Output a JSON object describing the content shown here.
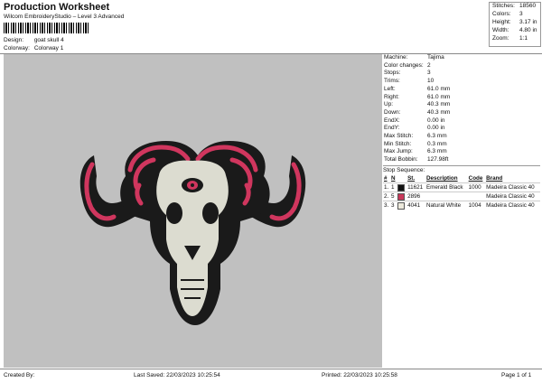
{
  "header": {
    "title": "Production Worksheet",
    "subtitle": "Wilcom EmbroideryStudio – Level 3 Advanced"
  },
  "meta": [
    {
      "label": "Design:",
      "value": "goat skull 4"
    },
    {
      "label": "Colorway:",
      "value": "Colorway 1"
    }
  ],
  "stats": [
    {
      "label": "Stitches:",
      "value": "18560"
    },
    {
      "label": "Colors:",
      "value": "3"
    },
    {
      "label": "Height:",
      "value": "3.17 in"
    },
    {
      "label": "Width:",
      "value": "4.80 in"
    },
    {
      "label": "Zoom:",
      "value": "1:1"
    }
  ],
  "properties": [
    {
      "label": "Machine:",
      "value": "Tajima"
    },
    {
      "label": "Color changes:",
      "value": "2"
    },
    {
      "label": "Stops:",
      "value": "3"
    },
    {
      "label": "Trims:",
      "value": "10"
    },
    {
      "label": "Left:",
      "value": "61.0 mm"
    },
    {
      "label": "Right:",
      "value": "61.0 mm"
    },
    {
      "label": "Up:",
      "value": "40.3 mm"
    },
    {
      "label": "Down:",
      "value": "40.3 mm"
    },
    {
      "label": "EndX:",
      "value": "0.00 in"
    },
    {
      "label": "EndY:",
      "value": "0.00 in"
    },
    {
      "label": "Max Stitch:",
      "value": "6.3 mm"
    },
    {
      "label": "Min Stitch:",
      "value": "0.3 mm"
    },
    {
      "label": "Max Jump:",
      "value": "6.3 mm"
    },
    {
      "label": "Total Bobbin:",
      "value": "127.98ft"
    }
  ],
  "stop_sequence": {
    "title": "Stop Sequence:",
    "headers": [
      "#",
      "N",
      "St.",
      "Description",
      "Code",
      "Brand"
    ],
    "rows": [
      {
        "idx": "1.",
        "n": "1",
        "color": "#111111",
        "stitches": "11621",
        "description": "Emerald Black",
        "code": "1000",
        "brand": "Madeira Classic 40"
      },
      {
        "idx": "2.",
        "n": "5",
        "color": "#c8385a",
        "stitches": "2896",
        "description": "",
        "code": "",
        "brand": "Madeira Classic 40"
      },
      {
        "idx": "3.",
        "n": "3",
        "color": "#ece9dc",
        "stitches": "4041",
        "description": "Natural White",
        "code": "1004",
        "brand": "Madeira Classic 40"
      }
    ]
  },
  "footer": {
    "created_by": "Created By:",
    "last_saved": "Last Saved: 22/03/2023 10:25:54",
    "printed": "Printed: 22/03/2023 10:25:58",
    "page": "Page 1 of 1"
  },
  "colors": {
    "canvas": "#c0c0c0",
    "outline": "#1a1a1a",
    "horn_red": "#d0365e",
    "bone": "#dcdcd0"
  }
}
